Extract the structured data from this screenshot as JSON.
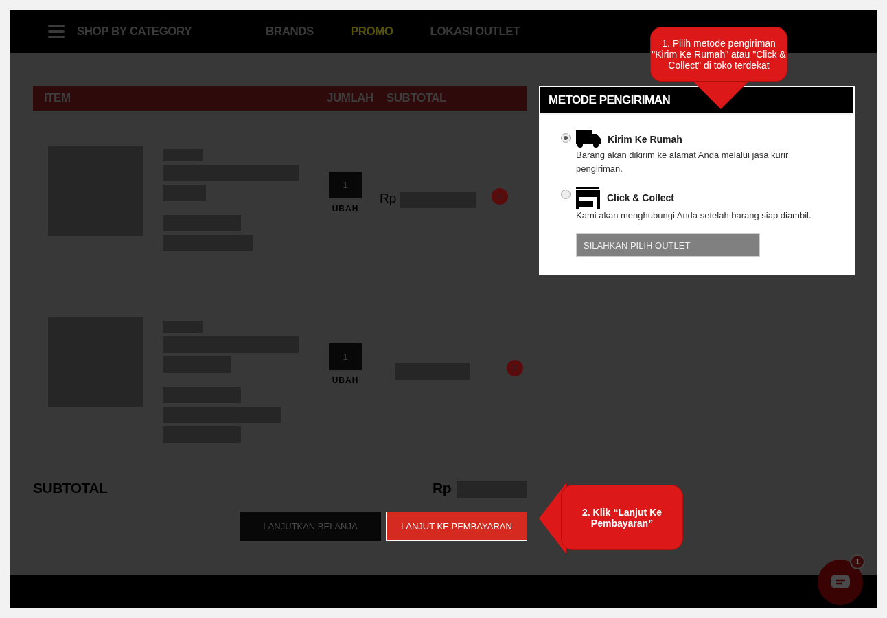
{
  "nav": {
    "categories_label": "SHOP BY CATEGORY",
    "links": [
      {
        "label": "BRANDS",
        "color": "#3a3a3a"
      },
      {
        "label": "PROMO",
        "color": "#55520a"
      },
      {
        "label": "LOKASI OUTLET",
        "color": "#3a3a3a"
      }
    ]
  },
  "cart": {
    "columns": [
      "ITEM",
      "JUMLAH",
      "SUBTOTAL"
    ],
    "items": [
      {
        "quantity": "1",
        "change_label": "UBAH",
        "currency": "Rp"
      },
      {
        "quantity": "1",
        "change_label": "UBAH"
      }
    ],
    "subtotal_label": "SUBTOTAL",
    "subtotal_currency": "Rp",
    "buttons": [
      {
        "label": "LANJUTKAN BELANJA",
        "kind": "secondary"
      },
      {
        "label": "LANJUT KE PEMBAYARAN",
        "kind": "primary"
      }
    ]
  },
  "shipping": {
    "title": "METODE PENGIRIMAN",
    "options": [
      {
        "kind": "truck",
        "title": "Kirim Ke Rumah",
        "description": "Barang akan dikirim ke alamat Anda melalui jasa kurir pengiriman.",
        "selected": true
      },
      {
        "kind": "store",
        "title": "Click & Collect",
        "description": "Kami akan menghubungi Anda setelah barang siap diambil.",
        "selected": false,
        "button": "SILAHKAN PILIH OUTLET"
      }
    ]
  },
  "callouts": [
    {
      "text": "1. Pilih metode pengiriman \"Kirim Ke Rumah\" atau \"Click & Collect\" di toko terdekat",
      "kind": "down"
    },
    {
      "text": "2. Klik “Lanjut Ke Pembayaran”",
      "kind": "left"
    }
  ],
  "chat": {
    "badge": "1"
  }
}
